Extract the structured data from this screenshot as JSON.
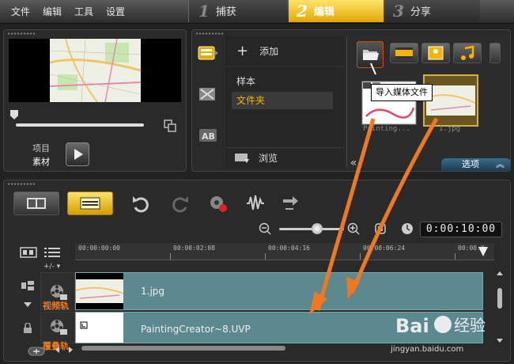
{
  "menu": [
    "文件",
    "编辑",
    "工具",
    "设置"
  ],
  "steps": [
    {
      "num": "1",
      "label": "捕获"
    },
    {
      "num": "2",
      "label": "编辑"
    },
    {
      "num": "3",
      "label": "分享"
    }
  ],
  "preview": {
    "mode_project": "项目",
    "mode_clip": "素材"
  },
  "library": {
    "add_label": "添加",
    "nav": [
      "样本",
      "文件夹"
    ],
    "browse_label": "浏览",
    "tooltip": "导入媒体文件",
    "thumbs": [
      {
        "caption": "Painting..."
      },
      {
        "caption": "1.jpg"
      }
    ],
    "options_label": "选项"
  },
  "timeline": {
    "timecode": "0:00:10:00",
    "ruler": [
      "00:00:00:00",
      "00:00:02:08",
      "00:00:04:16",
      "00:00:06:24",
      "00:00:0"
    ],
    "track_ctrl": "+/- ▾",
    "tracks": [
      {
        "label": "视频轨",
        "clip": "1.jpg"
      },
      {
        "label": "覆叠轨",
        "clip": "PaintingCreator~8.UVP"
      }
    ]
  },
  "watermark": {
    "brand": "Bai 经验",
    "url": "jingyan.baidu.com"
  },
  "colors": {
    "accent": "#f4b400",
    "annotation": "#f0791f",
    "clip": "#5c8890",
    "options": "#2a5674"
  }
}
